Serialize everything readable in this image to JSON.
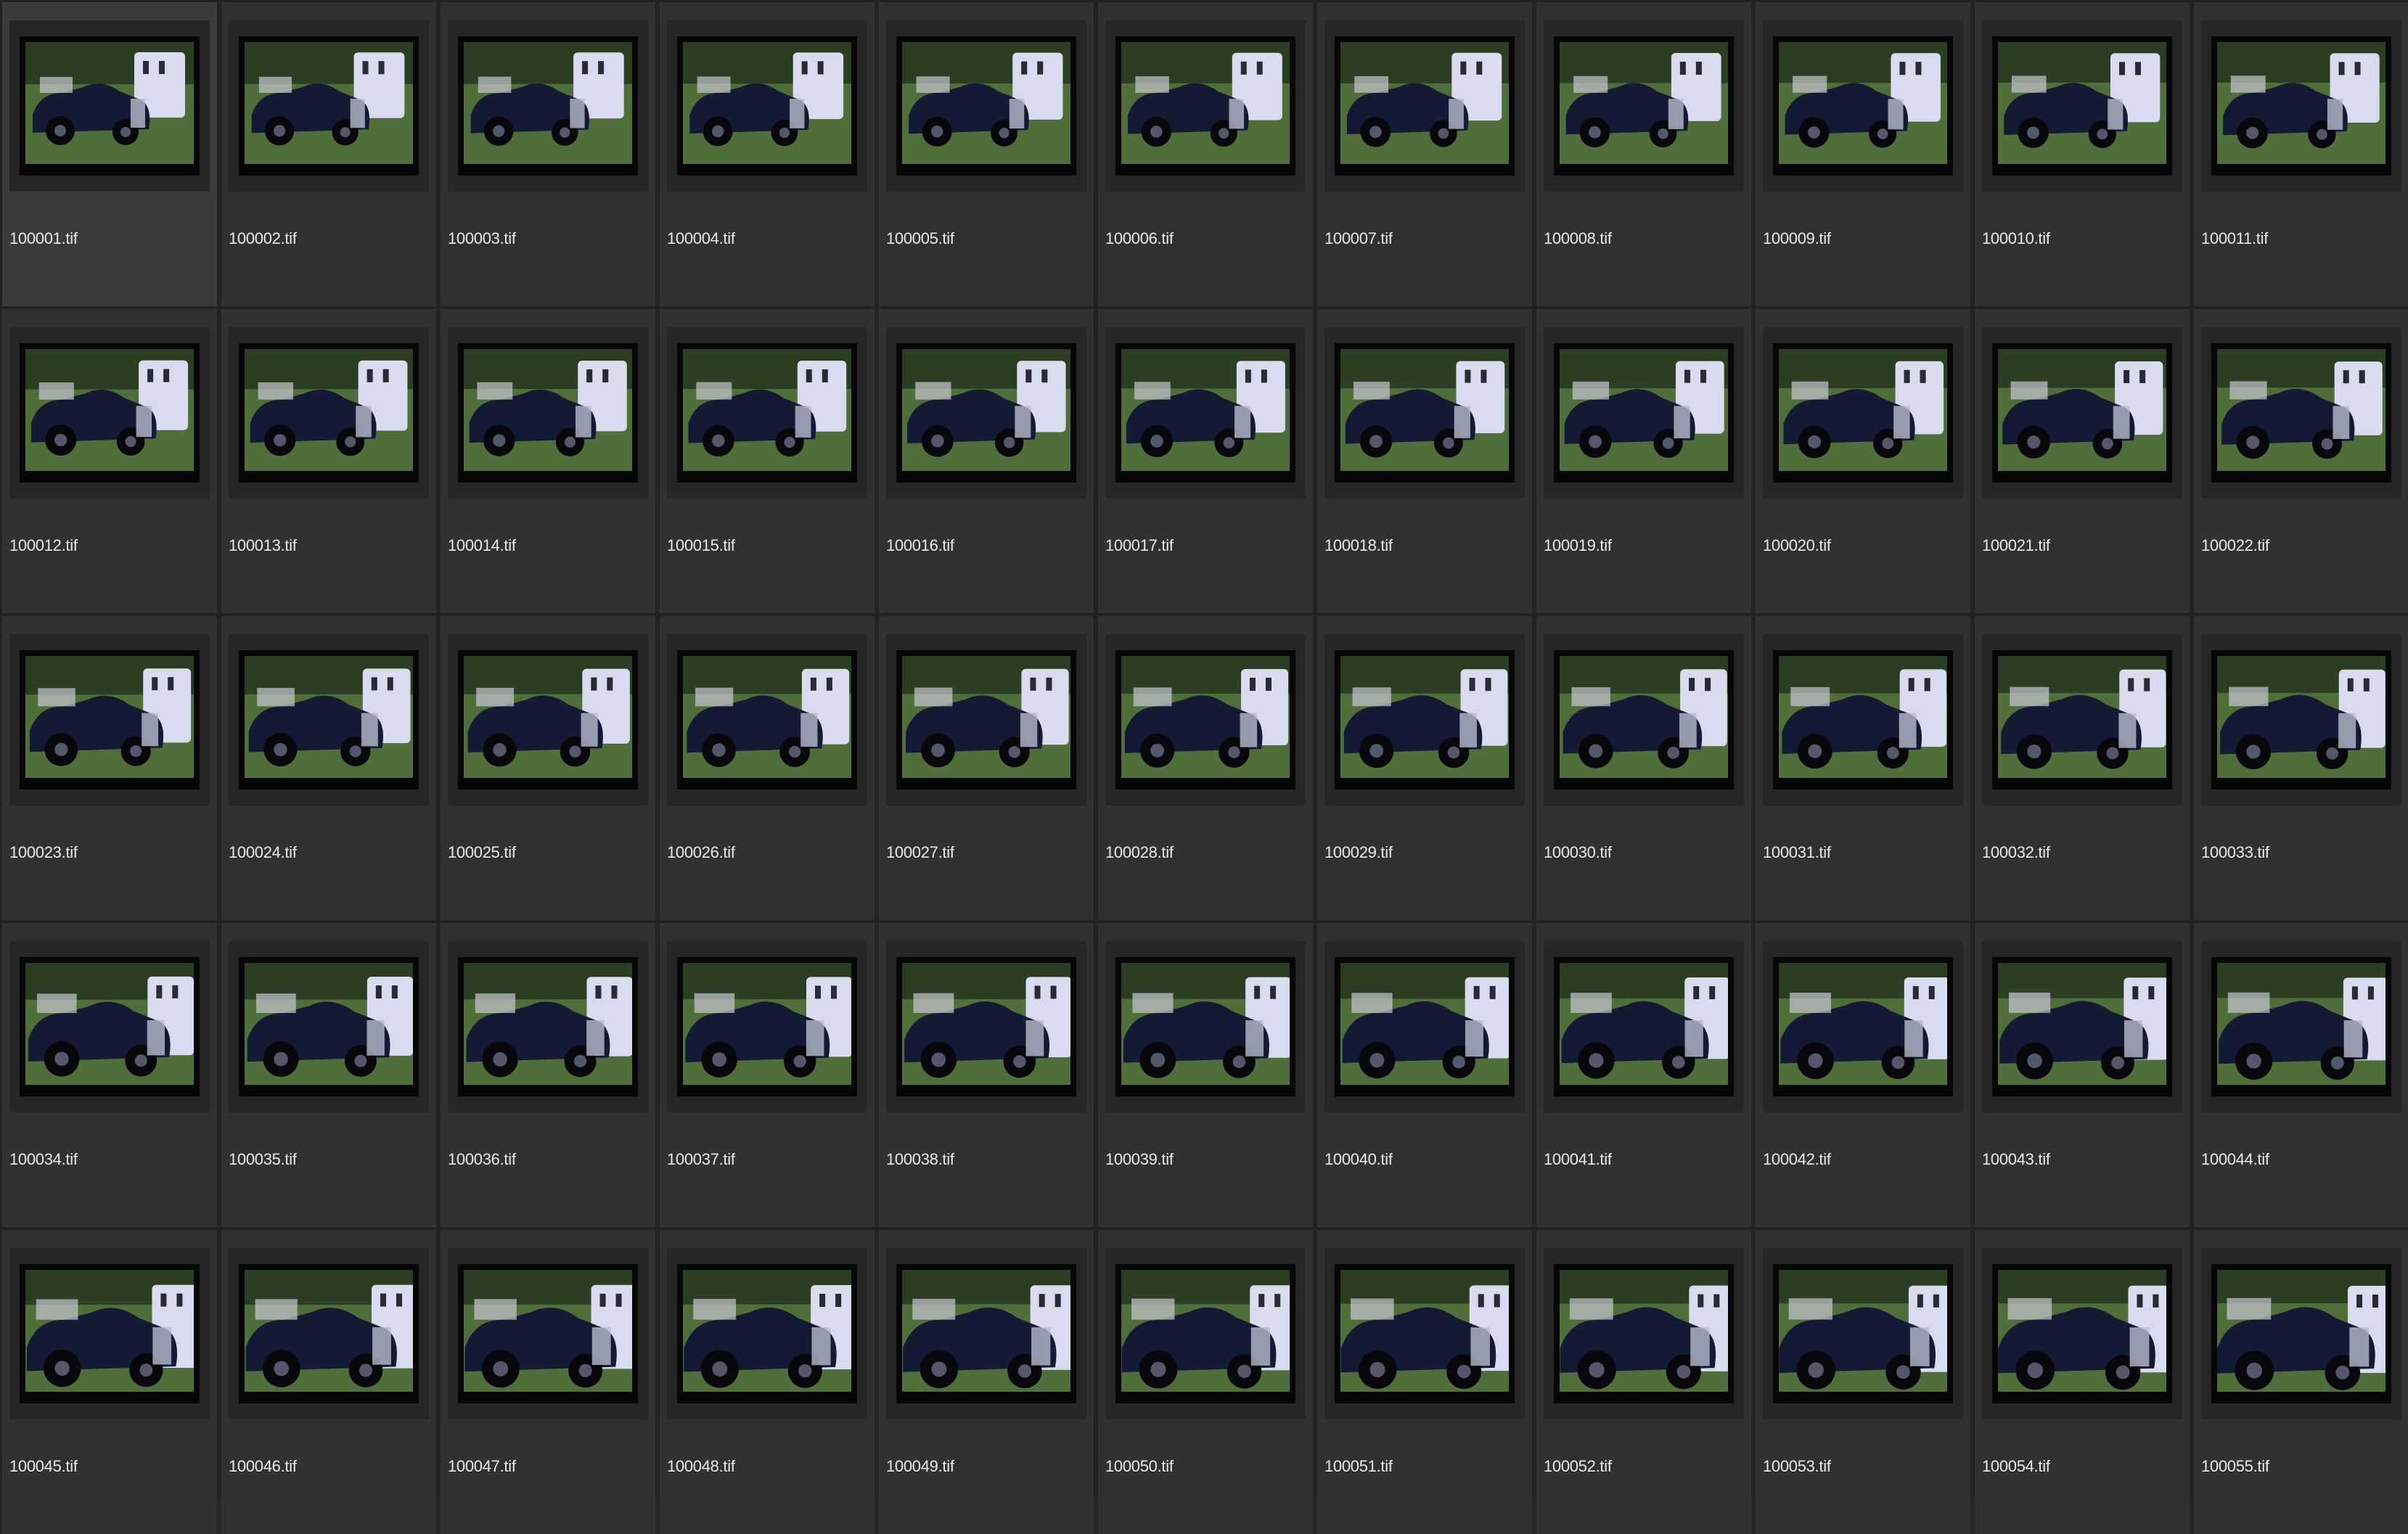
{
  "grid": {
    "columns": 11,
    "selected_index": 0,
    "items": [
      {
        "filename": "100001.tif"
      },
      {
        "filename": "100002.tif"
      },
      {
        "filename": "100003.tif"
      },
      {
        "filename": "100004.tif"
      },
      {
        "filename": "100005.tif"
      },
      {
        "filename": "100006.tif"
      },
      {
        "filename": "100007.tif"
      },
      {
        "filename": "100008.tif"
      },
      {
        "filename": "100009.tif"
      },
      {
        "filename": "100010.tif"
      },
      {
        "filename": "100011.tif"
      },
      {
        "filename": "100012.tif"
      },
      {
        "filename": "100013.tif"
      },
      {
        "filename": "100014.tif"
      },
      {
        "filename": "100015.tif"
      },
      {
        "filename": "100016.tif"
      },
      {
        "filename": "100017.tif"
      },
      {
        "filename": "100018.tif"
      },
      {
        "filename": "100019.tif"
      },
      {
        "filename": "100020.tif"
      },
      {
        "filename": "100021.tif"
      },
      {
        "filename": "100022.tif"
      },
      {
        "filename": "100023.tif"
      },
      {
        "filename": "100024.tif"
      },
      {
        "filename": "100025.tif"
      },
      {
        "filename": "100026.tif"
      },
      {
        "filename": "100027.tif"
      },
      {
        "filename": "100028.tif"
      },
      {
        "filename": "100029.tif"
      },
      {
        "filename": "100030.tif"
      },
      {
        "filename": "100031.tif"
      },
      {
        "filename": "100032.tif"
      },
      {
        "filename": "100033.tif"
      },
      {
        "filename": "100034.tif"
      },
      {
        "filename": "100035.tif"
      },
      {
        "filename": "100036.tif"
      },
      {
        "filename": "100037.tif"
      },
      {
        "filename": "100038.tif"
      },
      {
        "filename": "100039.tif"
      },
      {
        "filename": "100040.tif"
      },
      {
        "filename": "100041.tif"
      },
      {
        "filename": "100042.tif"
      },
      {
        "filename": "100043.tif"
      },
      {
        "filename": "100044.tif"
      },
      {
        "filename": "100045.tif"
      },
      {
        "filename": "100046.tif"
      },
      {
        "filename": "100047.tif"
      },
      {
        "filename": "100048.tif"
      },
      {
        "filename": "100049.tif"
      },
      {
        "filename": "100050.tif"
      },
      {
        "filename": "100051.tif"
      },
      {
        "filename": "100052.tif"
      },
      {
        "filename": "100053.tif"
      },
      {
        "filename": "100054.tif"
      },
      {
        "filename": "100055.tif"
      }
    ]
  },
  "colors": {
    "background": "#262626",
    "cell": "#313131",
    "caption_text": "#e9e9e9",
    "photo_grass": "#4f6e3a",
    "photo_trees": "#2b3d22",
    "photo_car": "#141a33",
    "photo_trailer": "#d9dcee"
  }
}
